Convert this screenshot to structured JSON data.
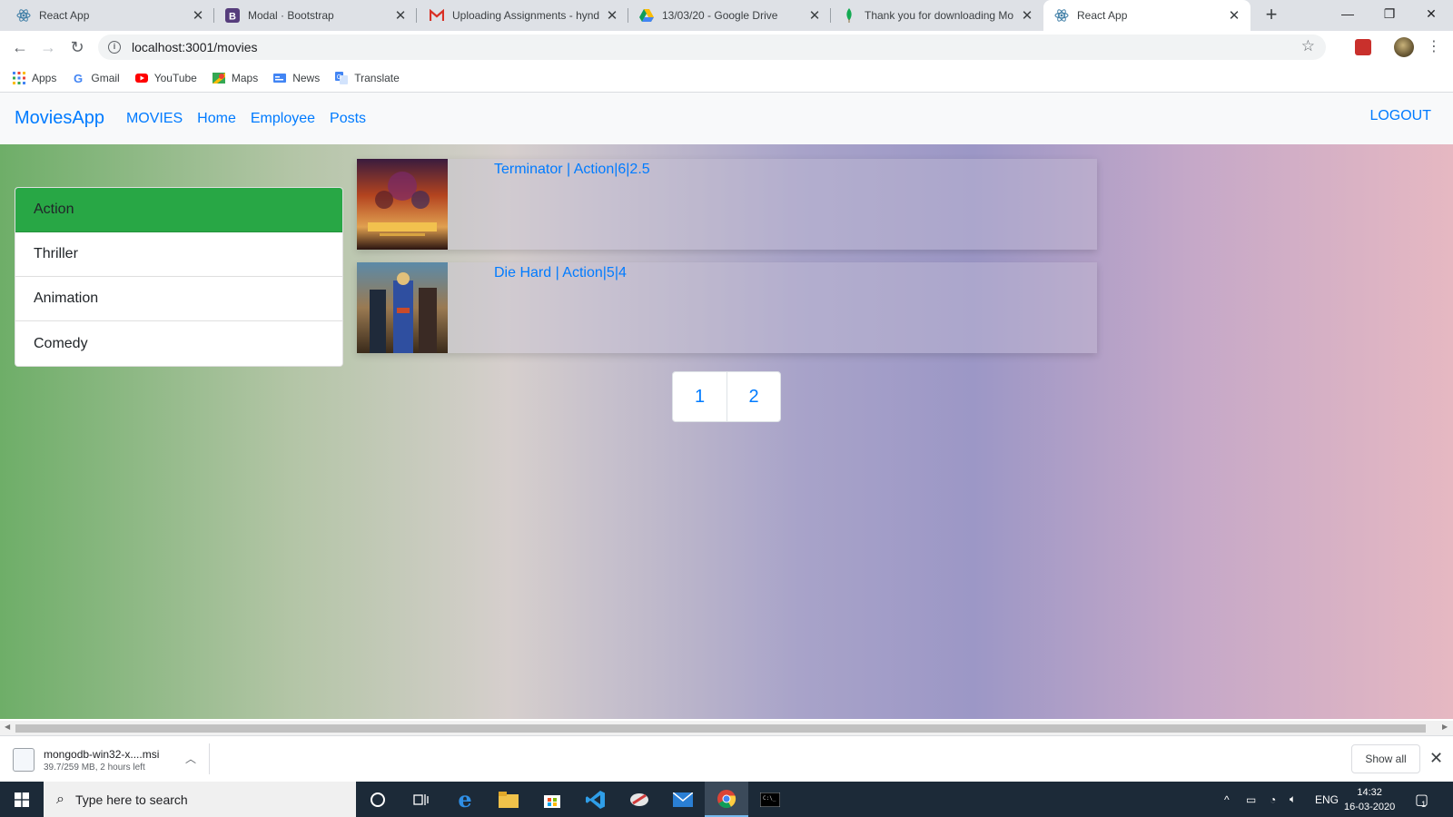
{
  "browser": {
    "tabs": [
      {
        "title": "React App",
        "icon": "react-icon",
        "active": false
      },
      {
        "title": "Modal · Bootstrap",
        "icon": "bootstrap-icon",
        "active": false
      },
      {
        "title": "Uploading Assignments - hynd",
        "icon": "gmail-icon",
        "active": false
      },
      {
        "title": "13/03/20 - Google Drive",
        "icon": "google-drive-icon",
        "active": false
      },
      {
        "title": "Thank you for downloading Mo",
        "icon": "mongodb-leaf-icon",
        "active": false
      },
      {
        "title": "React App",
        "icon": "react-icon",
        "active": true
      }
    ],
    "new_tab": "+",
    "url": "localhost:3001/movies",
    "bookmarks": [
      {
        "label": "Apps",
        "icon": "apps-grid-icon"
      },
      {
        "label": "Gmail",
        "icon": "google-icon"
      },
      {
        "label": "YouTube",
        "icon": "youtube-icon"
      },
      {
        "label": "Maps",
        "icon": "maps-icon"
      },
      {
        "label": "News",
        "icon": "news-icon"
      },
      {
        "label": "Translate",
        "icon": "translate-icon"
      }
    ]
  },
  "app": {
    "brand": "MoviesApp",
    "nav": [
      "MOVIES",
      "Home",
      "Employee",
      "Posts"
    ],
    "logout": "LOGOUT",
    "genres": [
      {
        "label": "Action",
        "active": true
      },
      {
        "label": "Thriller",
        "active": false
      },
      {
        "label": "Animation",
        "active": false
      },
      {
        "label": "Comedy",
        "active": false
      }
    ],
    "movies": [
      {
        "title": "Terminator | Action|6|2.5"
      },
      {
        "title": "Die Hard | Action|5|4"
      }
    ],
    "pages": [
      "1",
      "2"
    ],
    "colors": {
      "primary": "#007bff",
      "active_genre": "#28a745"
    }
  },
  "download": {
    "filename": "mongodb-win32-x....msi",
    "status": "39.7/259 MB, 2 hours left",
    "show_all": "Show all"
  },
  "taskbar": {
    "search_placeholder": "Type here to search",
    "language": "ENG",
    "time": "14:32",
    "date": "16-03-2020",
    "notification_count": "1"
  }
}
